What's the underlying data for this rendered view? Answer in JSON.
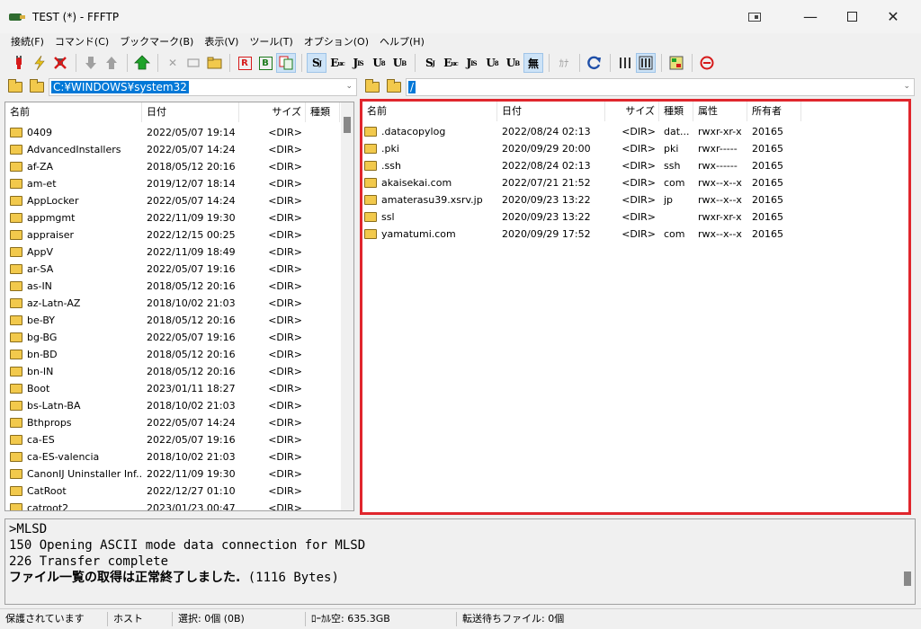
{
  "window": {
    "title": "TEST (*) - FFFTP"
  },
  "menu": [
    "接続(F)",
    "コマンド(C)",
    "ブックマーク(B)",
    "表示(V)",
    "ツール(T)",
    "オプション(O)",
    "ヘルプ(H)"
  ],
  "toolbar": {
    "local_path": "C:¥WINDOWS¥system32",
    "remote_path": "/",
    "buttons": {
      "s_sjis": "S",
      "e_euc": "E",
      "j_jis": "J",
      "u_utf8": "U",
      "u_utf8bom": "U",
      "mu": "無",
      "kana": "ｶﾅ",
      "r_box": "R",
      "b_box": "B"
    }
  },
  "local_pane": {
    "headers": {
      "name": "名前",
      "date": "日付",
      "size": "サイズ",
      "type": "種類"
    },
    "rows": [
      {
        "name": "0409",
        "date": "2022/05/07 19:14",
        "size": "<DIR>"
      },
      {
        "name": "AdvancedInstallers",
        "date": "2022/05/07 14:24",
        "size": "<DIR>"
      },
      {
        "name": "af-ZA",
        "date": "2018/05/12 20:16",
        "size": "<DIR>"
      },
      {
        "name": "am-et",
        "date": "2019/12/07 18:14",
        "size": "<DIR>"
      },
      {
        "name": "AppLocker",
        "date": "2022/05/07 14:24",
        "size": "<DIR>"
      },
      {
        "name": "appmgmt",
        "date": "2022/11/09 19:30",
        "size": "<DIR>"
      },
      {
        "name": "appraiser",
        "date": "2022/12/15 00:25",
        "size": "<DIR>"
      },
      {
        "name": "AppV",
        "date": "2022/11/09 18:49",
        "size": "<DIR>"
      },
      {
        "name": "ar-SA",
        "date": "2022/05/07 19:16",
        "size": "<DIR>"
      },
      {
        "name": "as-IN",
        "date": "2018/05/12 20:16",
        "size": "<DIR>"
      },
      {
        "name": "az-Latn-AZ",
        "date": "2018/10/02 21:03",
        "size": "<DIR>"
      },
      {
        "name": "be-BY",
        "date": "2018/05/12 20:16",
        "size": "<DIR>"
      },
      {
        "name": "bg-BG",
        "date": "2022/05/07 19:16",
        "size": "<DIR>"
      },
      {
        "name": "bn-BD",
        "date": "2018/05/12 20:16",
        "size": "<DIR>"
      },
      {
        "name": "bn-IN",
        "date": "2018/05/12 20:16",
        "size": "<DIR>"
      },
      {
        "name": "Boot",
        "date": "2023/01/11 18:27",
        "size": "<DIR>"
      },
      {
        "name": "bs-Latn-BA",
        "date": "2018/10/02 21:03",
        "size": "<DIR>"
      },
      {
        "name": "Bthprops",
        "date": "2022/05/07 14:24",
        "size": "<DIR>"
      },
      {
        "name": "ca-ES",
        "date": "2022/05/07 19:16",
        "size": "<DIR>"
      },
      {
        "name": "ca-ES-valencia",
        "date": "2018/10/02 21:03",
        "size": "<DIR>"
      },
      {
        "name": "CanonIJ Uninstaller Inf...",
        "date": "2022/11/09 19:30",
        "size": "<DIR>"
      },
      {
        "name": "CatRoot",
        "date": "2022/12/27 01:10",
        "size": "<DIR>"
      },
      {
        "name": "catroot2",
        "date": "2023/01/23 00:47",
        "size": "<DIR>"
      }
    ]
  },
  "remote_pane": {
    "headers": {
      "name": "名前",
      "date": "日付",
      "size": "サイズ",
      "type": "種類",
      "perm": "属性",
      "owner": "所有者"
    },
    "rows": [
      {
        "name": ".datacopylog",
        "date": "2022/08/24 02:13",
        "size": "<DIR>",
        "type": "dat...",
        "perm": "rwxr-xr-x",
        "owner": "20165"
      },
      {
        "name": ".pki",
        "date": "2020/09/29 20:00",
        "size": "<DIR>",
        "type": "pki",
        "perm": "rwxr-----",
        "owner": "20165"
      },
      {
        "name": ".ssh",
        "date": "2022/08/24 02:13",
        "size": "<DIR>",
        "type": "ssh",
        "perm": "rwx------",
        "owner": "20165"
      },
      {
        "name": "akaisekai.com",
        "date": "2022/07/21 21:52",
        "size": "<DIR>",
        "type": "com",
        "perm": "rwx--x--x",
        "owner": "20165"
      },
      {
        "name": "amaterasu39.xsrv.jp",
        "date": "2020/09/23 13:22",
        "size": "<DIR>",
        "type": "jp",
        "perm": "rwx--x--x",
        "owner": "20165"
      },
      {
        "name": "ssl",
        "date": "2020/09/23 13:22",
        "size": "<DIR>",
        "type": "",
        "perm": "rwxr-xr-x",
        "owner": "20165"
      },
      {
        "name": "yamatumi.com",
        "date": "2020/09/29 17:52",
        "size": "<DIR>",
        "type": "com",
        "perm": "rwx--x--x",
        "owner": "20165"
      }
    ]
  },
  "log": {
    "lines": [
      ">MLSD",
      "150 Opening ASCII mode data connection for MLSD",
      "226 Transfer complete"
    ],
    "last_bold": "ファイル一覧の取得は正常終了しました.",
    "last_tail": " (1116 Bytes)"
  },
  "status": {
    "secure": "保護されています",
    "host": "ホスト",
    "selected": "選択: 0個 (0B)",
    "local_free": "ﾛｰｶﾙ空: 635.3GB",
    "queue": "転送待ちファイル: 0個"
  },
  "colors": {
    "highlight_border": "#e0262d",
    "selection_bg": "#0078d7",
    "folder": "#f2c94c"
  }
}
